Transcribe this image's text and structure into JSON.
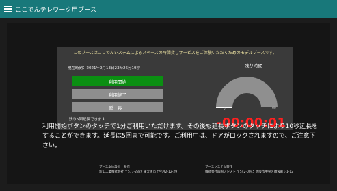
{
  "app": {
    "title": "ここでんテレワーク用ブース"
  },
  "notice": "このブースはここでんシステムによるスペースの時間貸しサービスをご体験いただくためのモデルブースです。",
  "clock": "現在時刻：2021年9月13日23時26分19秒",
  "buttons": {
    "start": "利用開始",
    "end": "利用終了",
    "extend": "延長"
  },
  "extension_remaining": "残り5回延長できます",
  "timer": {
    "label": "残り時間",
    "gauge_min": "0",
    "gauge_max": "60",
    "gauge_value_minutes": 0,
    "countdown": "-00:00:01"
  },
  "instructions": "利用開始ボタンのタッチで1分ご利用いただけます。その後も延長ボタンのタッチにより10秒延長をすることができます。延長は5回まで可能です。ご利用中は、ドアがロックされますので、ご注意下さい。",
  "footer": {
    "left": {
      "caption": "ブース本体設計・製作",
      "company": "新山工業株式会社 〒577-2827 東大阪市上今月2-12-29"
    },
    "right": {
      "caption": "ブースシステム製作",
      "company": "株式会社四国アシスト 〒542-0045 大阪市中央区難波町1-1-12"
    }
  },
  "colors": {
    "topbar": "#18787a",
    "start_button": "#0b8f12",
    "countdown": "#ff2020"
  }
}
